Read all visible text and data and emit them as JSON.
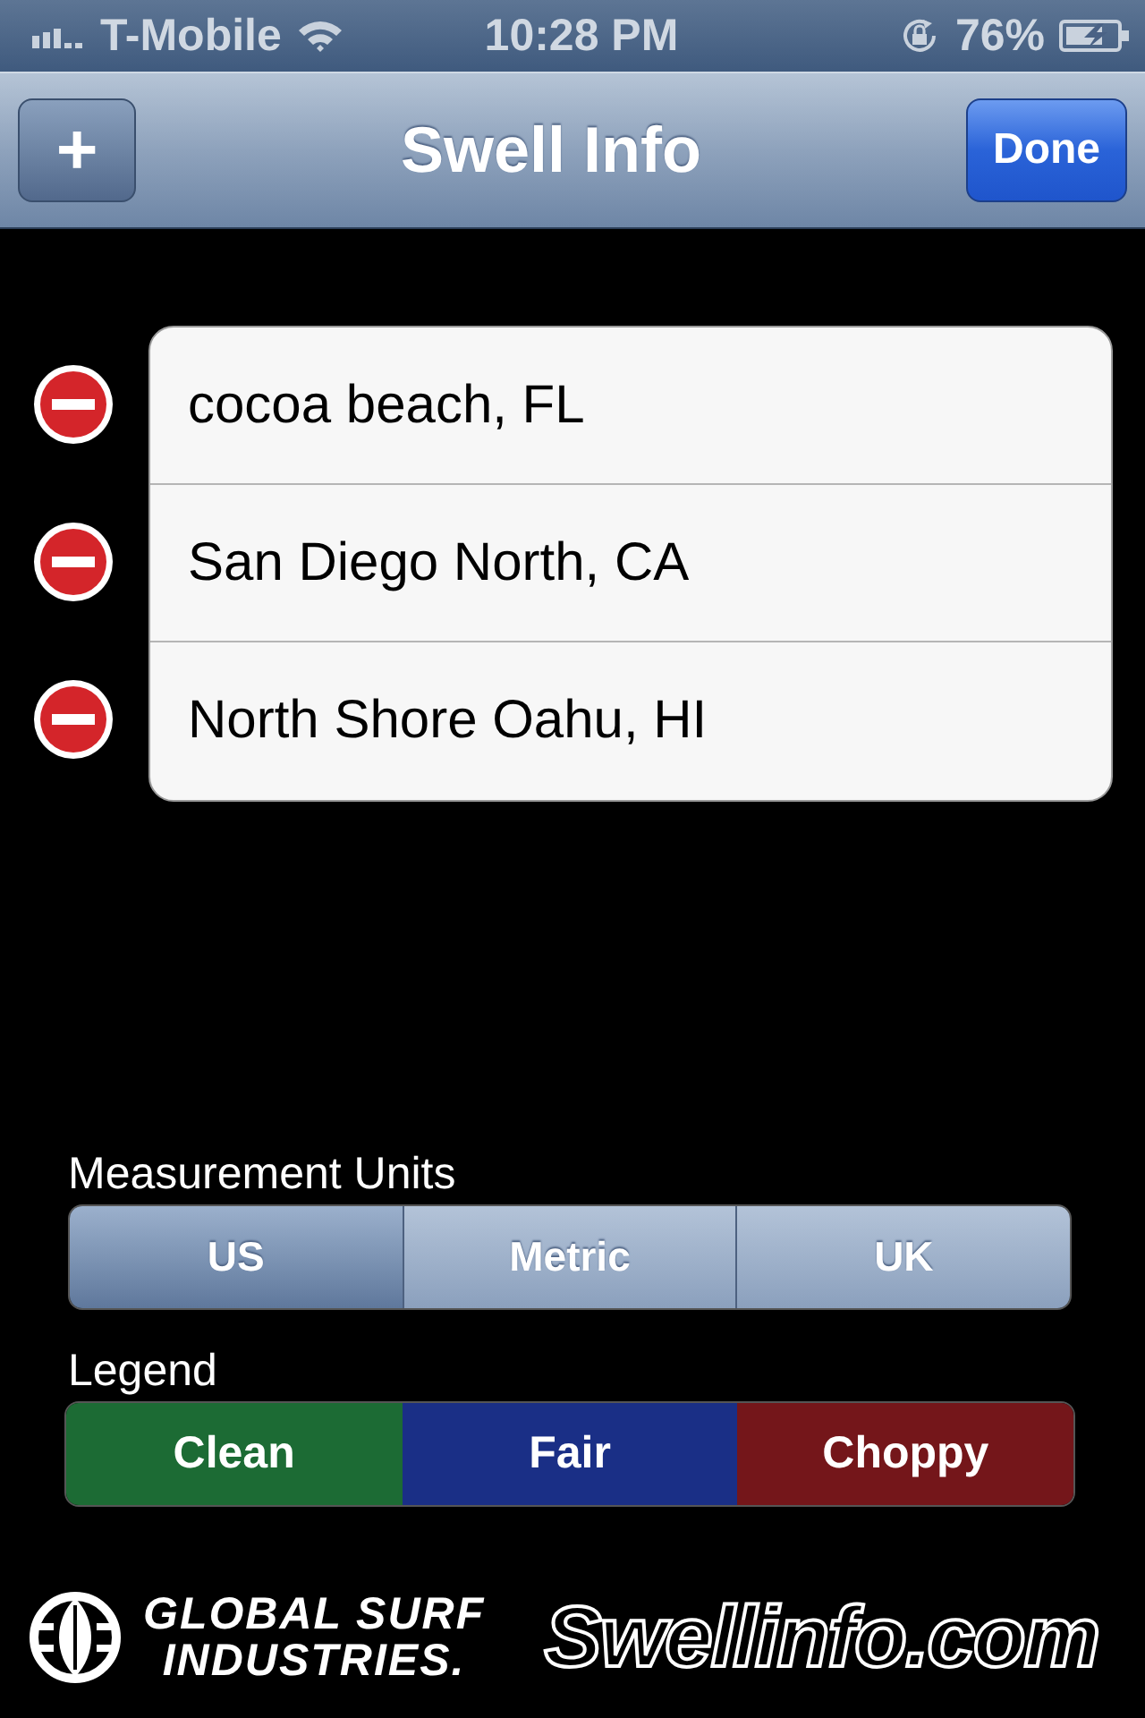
{
  "status_bar": {
    "carrier": "T-Mobile",
    "time": "10:28 PM",
    "battery": "76%"
  },
  "nav": {
    "add_button": "+",
    "title": "Swell Info",
    "done_button": "Done"
  },
  "locations": [
    {
      "name": "cocoa beach, FL"
    },
    {
      "name": "San Diego North, CA"
    },
    {
      "name": "North Shore Oahu, HI"
    }
  ],
  "units": {
    "label": "Measurement Units",
    "options": [
      {
        "label": "US",
        "selected": true
      },
      {
        "label": "Metric",
        "selected": false
      },
      {
        "label": "UK",
        "selected": false
      }
    ]
  },
  "legend": {
    "label": "Legend",
    "items": [
      {
        "label": "Clean",
        "color": "#1c6b34"
      },
      {
        "label": "Fair",
        "color": "#1a2f86"
      },
      {
        "label": "Choppy",
        "color": "#74161a"
      }
    ]
  },
  "footer": {
    "left_logo": [
      "GLOBAL SURF",
      "INDUSTRIES."
    ],
    "right_logo": "Swellinfo.com"
  }
}
